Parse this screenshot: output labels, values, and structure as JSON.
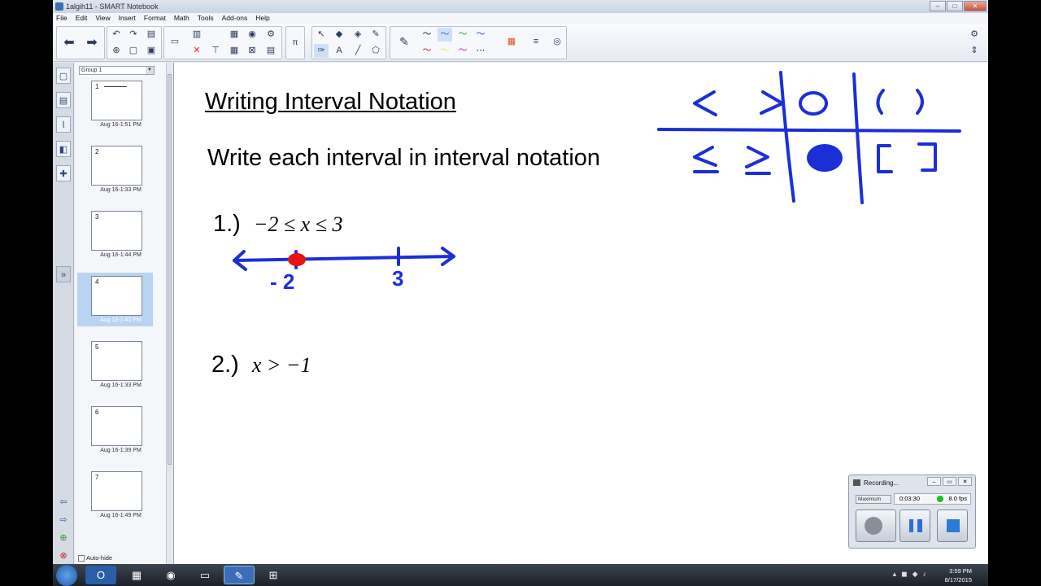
{
  "window": {
    "title": "1algih11 - SMART Notebook",
    "minimize": "–",
    "maximize": "□",
    "close": "✕"
  },
  "menu": [
    "File",
    "Edit",
    "View",
    "Insert",
    "Format",
    "Math",
    "Tools",
    "Add-ons",
    "Help"
  ],
  "sorter": {
    "group": "Group 1",
    "pages": [
      {
        "num": "1",
        "label": "Aug 16-1:51 PM"
      },
      {
        "num": "2",
        "label": "Aug 16-1:33 PM"
      },
      {
        "num": "3",
        "label": "Aug 16-1:44 PM"
      },
      {
        "num": "4",
        "label": "Aug 16-1:40 PM"
      },
      {
        "num": "5",
        "label": "Aug 16-1:33 PM"
      },
      {
        "num": "6",
        "label": "Aug 16-1:39 PM"
      },
      {
        "num": "7",
        "label": "Aug 16-1:49 PM"
      }
    ],
    "auto_hide": "Auto-hide"
  },
  "slide": {
    "title": "Writing Interval Notation",
    "subtitle": "Write each interval in interval notation",
    "problems": [
      {
        "num": "1.)",
        "expr": "−2 ≤ x ≤ 3"
      },
      {
        "num": "2.)",
        "expr": "x > −1"
      }
    ],
    "numberline_labels": [
      "- 2",
      "3"
    ]
  },
  "recorder": {
    "title": "Recording...",
    "mode": "Maximum",
    "time": "0:03:30",
    "fps": "8.0 fps"
  },
  "taskbar": {
    "time": "3:59 PM",
    "date": "8/17/2015"
  },
  "colors": {
    "ink_blue": "#1c2fd6",
    "ink_red": "#e81313",
    "selected_page": "#b9d4f3"
  }
}
